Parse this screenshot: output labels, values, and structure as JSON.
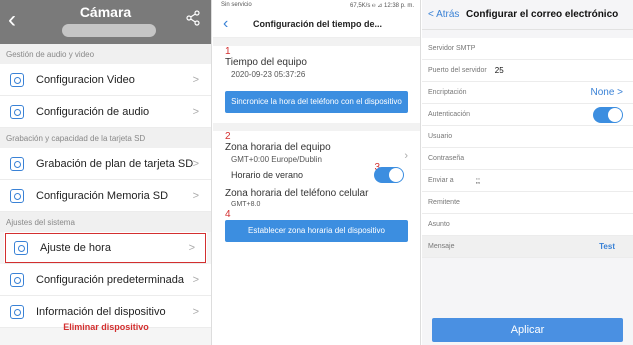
{
  "p1": {
    "title": "Cámara",
    "sections": [
      {
        "header": "Gestión de audio y video",
        "items": [
          "Configuracion Video",
          "Configuración de audio"
        ]
      },
      {
        "header": "Grabación y capacidad de la tarjeta SD",
        "items": [
          "Grabación de plan de tarjeta SD",
          "Configuración Memoria SD"
        ]
      },
      {
        "header": "Ajustes del sistema",
        "items": [
          "Ajuste de hora",
          "Configuración predeterminada",
          "Información del dispositivo"
        ]
      }
    ],
    "delete_label": "Eliminar dispositivo",
    "chevron": ">"
  },
  "p2": {
    "status_left": "Sin servicio",
    "status_right": "67,5K/s ℮ ⊿ 12:38 p. m.",
    "title": "Configuración del tiempo de...",
    "n1": "1",
    "device_time_label": "Tiempo del equipo",
    "device_time_value": "2020-09-23 05:37:26",
    "sync_button": "Sincronice la hora del teléfono con el dispositivo",
    "n2": "2",
    "device_tz_label": "Zona horaria del equipo",
    "device_tz_value": "GMT+0:00 Europe/Dublin",
    "dst_label": "Horario de verano",
    "n3": "3",
    "phone_tz_label": "Zona horaria del teléfono celular",
    "phone_tz_value": "GMT+8.0",
    "n4": "4",
    "set_tz_button": "Establecer zona horaria del dispositivo"
  },
  "p3": {
    "back": "< Atrás",
    "title": "Configurar el correo electrónico",
    "rows": [
      {
        "label": "Servidor SMTP",
        "value": ""
      },
      {
        "label": "Puerto del servidor",
        "value": "25"
      },
      {
        "label": "Encriptación",
        "value": ""
      },
      {
        "label": "Autenticación",
        "value": ""
      },
      {
        "label": "Usuario",
        "value": ""
      },
      {
        "label": "Contraseña",
        "value": ""
      },
      {
        "label": "Enviar a",
        "value": ";;"
      },
      {
        "label": "Remitente",
        "value": ""
      },
      {
        "label": "Asunto",
        "value": ""
      }
    ],
    "encryption_value": "None >",
    "message_label": "Mensaje",
    "test_label": "Test",
    "apply": "Aplicar"
  }
}
